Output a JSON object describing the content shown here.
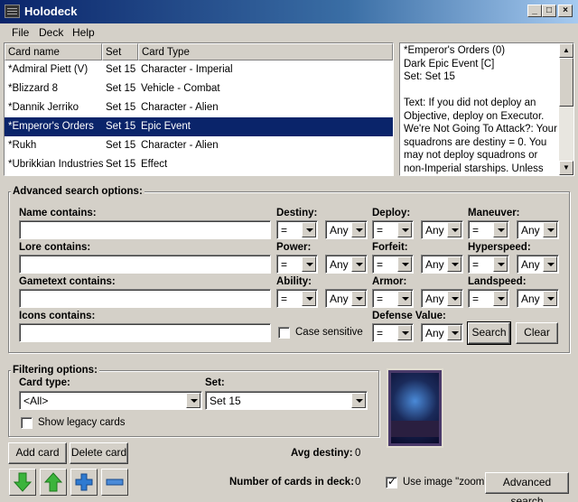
{
  "window": {
    "title": "Holodeck",
    "controls": [
      "_",
      "□",
      "×"
    ]
  },
  "menu": [
    "File",
    "Deck",
    "Help"
  ],
  "table": {
    "headers": [
      "Card name",
      "Set",
      "Card Type"
    ],
    "rows": [
      {
        "name": "*Admiral Piett (V)",
        "set": "Set 15",
        "type": "Character - Imperial"
      },
      {
        "name": "*Blizzard 8",
        "set": "Set 15",
        "type": "Vehicle - Combat"
      },
      {
        "name": "*Dannik Jerriko",
        "set": "Set 15",
        "type": "Character - Alien"
      },
      {
        "name": "*Emperor's Orders",
        "set": "Set 15",
        "type": "Epic Event"
      },
      {
        "name": "*Rukh",
        "set": "Set 15",
        "type": "Character - Alien"
      },
      {
        "name": "*Ubrikkian Industries",
        "set": "Set 15",
        "type": "Effect"
      }
    ],
    "selected_index": 3
  },
  "detail": {
    "text": "*Emperor's Orders (0)\nDark Epic Event [C]\nSet: Set 15\n\nText: If you did not deploy an Objective, deploy on Executor. We're Not Going To Attack?: Your squadrons are destiny = 0. You may not deploy squadrons or non-Imperial starships. Unless you occupy a battleground site, c..."
  },
  "advanced": {
    "title": "Advanced search options:",
    "name_label": "Name contains:",
    "lore_label": "Lore contains:",
    "gametext_label": "Gametext contains:",
    "icons_label": "Icons contains:",
    "destiny_label": "Destiny:",
    "deploy_label": "Deploy:",
    "maneuver_label": "Maneuver:",
    "power_label": "Power:",
    "forfeit_label": "Forfeit:",
    "hyperspeed_label": "Hyperspeed:",
    "ability_label": "Ability:",
    "armor_label": "Armor:",
    "landspeed_label": "Landspeed:",
    "defense_label": "Defense Value:",
    "op_value": "=",
    "any_value": "Any",
    "case_sensitive": "Case sensitive",
    "search_button": "Search",
    "clear_button": "Clear"
  },
  "filtering": {
    "title": "Filtering options:",
    "card_type_label": "Card type:",
    "card_type_value": "<All>",
    "set_label": "Set:",
    "set_value": "Set 15",
    "legacy_label": "Show legacy cards"
  },
  "bottom": {
    "add_card": "Add card",
    "delete_card": "Delete card",
    "avg_destiny_label": "Avg destiny:",
    "avg_destiny_value": "0",
    "num_cards_label": "Number of cards in deck:",
    "num_cards_value": "0",
    "zoom_label": "Use image \"zoom\"",
    "zoom_checked": true,
    "advanced_search_button": "Advanced search"
  },
  "icons": [
    "app-icon",
    "arrow-down-icon",
    "arrow-up-icon",
    "plus-icon",
    "minus-icon"
  ],
  "colors": {
    "selection": "#0a246a",
    "titlebar": "#0a246a",
    "arrow_green": "#3cb43c",
    "plus_blue": "#2e7ad1"
  }
}
